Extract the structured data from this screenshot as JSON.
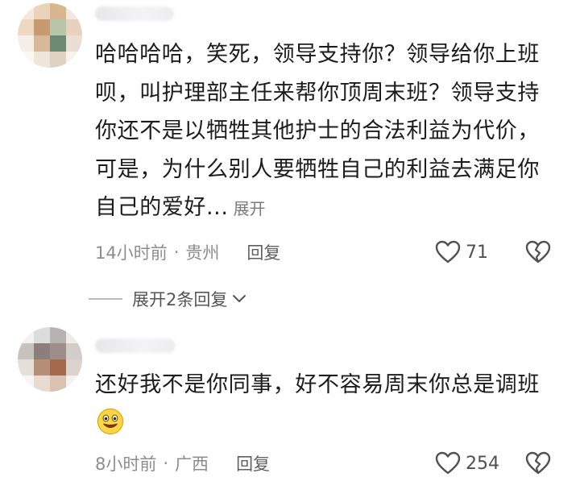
{
  "comments": [
    {
      "text": "哈哈哈哈，笑死，领导支持你？领导给你上班呗，叫护理部主任来帮你顶周末班？领导支持你还不是以牺牲其他护士的合法利益为代价，可是，为什么别人要牺牲自己的利益去满足你自己的爱好...",
      "expand_label": "展开",
      "time": "14小时前",
      "separator": "·",
      "location": "贵州",
      "reply_label": "回复",
      "likes": "71"
    },
    {
      "text": "还好我不是你同事，好不容易周末你总是调班",
      "time": "8小时前",
      "separator": "·",
      "location": "广西",
      "reply_label": "回复",
      "likes": "254"
    }
  ],
  "expand_replies_label": "展开2条回复",
  "icons": {
    "like": "heart-outline-icon",
    "dislike": "broken-heart-icon",
    "expand": "chevron-down-icon",
    "emoji": "grinning-face-emoji"
  },
  "colors": {
    "text": "#1c1c1c",
    "meta": "#8d8d8d",
    "icon": "#505050"
  }
}
